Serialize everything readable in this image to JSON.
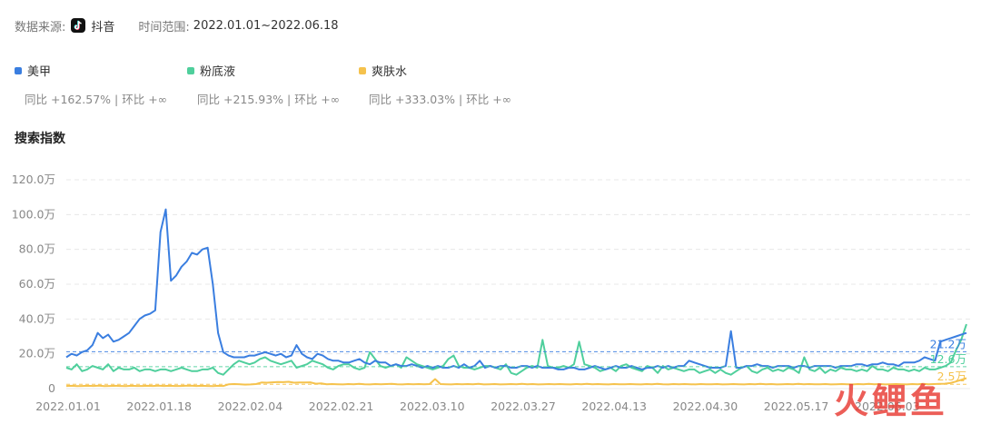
{
  "meta": {
    "source_label": "数据来源:",
    "source_value": "抖音",
    "range_label": "时间范围:",
    "range_value": "2022.01.01~2022.06.18"
  },
  "legend": [
    {
      "name": "美甲",
      "color": "#3a7ee0",
      "stats": "同比 +162.57% | 环比 +∞"
    },
    {
      "name": "粉底液",
      "color": "#4fcf9c",
      "stats": "同比 +215.93% | 环比 +∞"
    },
    {
      "name": "爽肤水",
      "color": "#f5c24d",
      "stats": "同比 +333.03% | 环比 +∞"
    }
  ],
  "section_title": "搜索指数",
  "watermark": "火鲤鱼",
  "chart_data": {
    "type": "line",
    "x_ticks": [
      "2022.01.01",
      "2022.01.18",
      "2022.02.04",
      "2022.02.21",
      "2022.03.10",
      "2022.03.27",
      "2022.04.13",
      "2022.04.30",
      "2022.05.17",
      "2022.06.03"
    ],
    "y_ticks": [
      "120.0万",
      "100.0万",
      "80.0万",
      "60.0万",
      "40.0万",
      "20.0万",
      "0"
    ],
    "y_tick_values": [
      120,
      100,
      80,
      60,
      40,
      20,
      0
    ],
    "ylim": [
      0,
      120
    ],
    "y_unit": "万",
    "grid": true,
    "reference_lines": [
      {
        "label": "21.2万",
        "value": 21.2,
        "color": "#3a7ee0"
      },
      {
        "label": "12.6万",
        "value": 12.6,
        "color": "#4fcf9c"
      },
      {
        "label": "2.5万",
        "value": 2.5,
        "color": "#f5c24d"
      }
    ],
    "series": [
      {
        "name": "美甲",
        "color": "#3a7ee0",
        "values": [
          18,
          20,
          19,
          21,
          22,
          25,
          32,
          29,
          31,
          27,
          28,
          30,
          32,
          36,
          40,
          42,
          43,
          45,
          90,
          103,
          62,
          65,
          70,
          73,
          78,
          77,
          80,
          81,
          60,
          32,
          21,
          19,
          18,
          18,
          18,
          19,
          19,
          20,
          21,
          20,
          19,
          20,
          18,
          19,
          25,
          20,
          18,
          17,
          20,
          19,
          17,
          16,
          16,
          15,
          15,
          16,
          17,
          15,
          14,
          16,
          15,
          15,
          13,
          14,
          13,
          13,
          14,
          13,
          12,
          13,
          12,
          13,
          12,
          12,
          13,
          12,
          14,
          12,
          13,
          16,
          12,
          13,
          12,
          13,
          13,
          12,
          12,
          13,
          13,
          12,
          13,
          12,
          12,
          12,
          11,
          11,
          12,
          12,
          11,
          11,
          12,
          13,
          12,
          11,
          12,
          13,
          12,
          12,
          13,
          12,
          11,
          12,
          12,
          13,
          12,
          13,
          12,
          13,
          13,
          16,
          15,
          14,
          13,
          12,
          12,
          12,
          13,
          33,
          12,
          12,
          13,
          13,
          14,
          13,
          13,
          12,
          13,
          13,
          13,
          12,
          13,
          13,
          12,
          13,
          13,
          13,
          13,
          12,
          13,
          13,
          13,
          14,
          14,
          13,
          14,
          14,
          15,
          14,
          14,
          13,
          15,
          15,
          15,
          16,
          18,
          17,
          16,
          27,
          28,
          29,
          30,
          31,
          32
        ]
      },
      {
        "name": "粉底液",
        "color": "#4fcf9c",
        "values": [
          12,
          11,
          14,
          10,
          11,
          13,
          12,
          11,
          14,
          10,
          12,
          11,
          11,
          12,
          10,
          11,
          11,
          10,
          11,
          11,
          10,
          11,
          12,
          11,
          10,
          10,
          11,
          11,
          12,
          9,
          8,
          11,
          14,
          16,
          15,
          14,
          15,
          17,
          18,
          16,
          15,
          14,
          15,
          16,
          12,
          13,
          14,
          16,
          15,
          14,
          12,
          11,
          13,
          14,
          14,
          12,
          11,
          12,
          21,
          17,
          13,
          12,
          13,
          14,
          12,
          18,
          16,
          14,
          13,
          12,
          11,
          12,
          13,
          17,
          19,
          13,
          12,
          12,
          11,
          12,
          13,
          13,
          12,
          11,
          14,
          9,
          8,
          10,
          12,
          13,
          12,
          28,
          13,
          12,
          12,
          13,
          12,
          14,
          27,
          14,
          13,
          12,
          10,
          11,
          12,
          10,
          13,
          14,
          12,
          11,
          10,
          13,
          12,
          9,
          13,
          11,
          12,
          11,
          10,
          11,
          11,
          9,
          10,
          11,
          9,
          11,
          9,
          8,
          10,
          12,
          13,
          10,
          9,
          11,
          12,
          10,
          11,
          10,
          12,
          11,
          9,
          18,
          11,
          10,
          12,
          9,
          11,
          10,
          12,
          11,
          11,
          10,
          11,
          10,
          13,
          11,
          11,
          10,
          12,
          11,
          11,
          10,
          11,
          10,
          12,
          11,
          11,
          12,
          13,
          15,
          22,
          28,
          37
        ]
      },
      {
        "name": "爽肤水",
        "color": "#f5c24d",
        "values": [
          1.5,
          1.6,
          1.4,
          1.5,
          1.6,
          1.5,
          1.7,
          1.4,
          1.5,
          1.6,
          1.5,
          1.4,
          1.6,
          1.5,
          1.5,
          1.6,
          1.5,
          1.7,
          1.5,
          1.6,
          1.5,
          1.5,
          1.6,
          1.7,
          1.5,
          1.6,
          1.5,
          1.4,
          1.6,
          1.5,
          2.5,
          2.6,
          2.5,
          2.3,
          2.4,
          2.6,
          3.5,
          3.4,
          3.6,
          3.8,
          3.7,
          3.9,
          3.4,
          3.5,
          3.5,
          3.6,
          2.8,
          3,
          2.5,
          2.6,
          2.5,
          2.4,
          2.6,
          2.5,
          2.7,
          2.5,
          2.4,
          2.6,
          2.5,
          2.6,
          2.7,
          2.5,
          2.4,
          2.6,
          2.5,
          2.6,
          2.5,
          2.6,
          5.5,
          2.6,
          2.5,
          2.4,
          2.6,
          2.5,
          2.6,
          2.5,
          2.7,
          2.4,
          2.5,
          2.6,
          2.4,
          2.5,
          2.6,
          2.5,
          2.7,
          2.5,
          2.6,
          2.4,
          2.5,
          2.6,
          2.5,
          2.6,
          2.5,
          2.4,
          2.6,
          2.5,
          2.7,
          2.5,
          2.6,
          2.5,
          2.4,
          2.6,
          2.5,
          2.5,
          2.6,
          2.5,
          2.4,
          2.6,
          2.5,
          2.7,
          2.5,
          2.4,
          2.6,
          2.5,
          2.6,
          2.5,
          2.4,
          2.6,
          2.5,
          2.5,
          2.6,
          2.4,
          2.5,
          2.6,
          2.5,
          2.4,
          2.6,
          2.5,
          2.7,
          2.5,
          2.6,
          2.4,
          2.5,
          2.6,
          2.5,
          2.7,
          2.5,
          2.6,
          2.5,
          2.5,
          2.6,
          2.4,
          2.5,
          2.6,
          2.5,
          2.4,
          2.6,
          2.5,
          2.7,
          2.5,
          2.6,
          2.4,
          2.5,
          2.6,
          2.5,
          2.4,
          2.6,
          2.5,
          2.7,
          2.5,
          2.6,
          2.7,
          2.8,
          3.2,
          4,
          5,
          6
        ]
      }
    ]
  }
}
